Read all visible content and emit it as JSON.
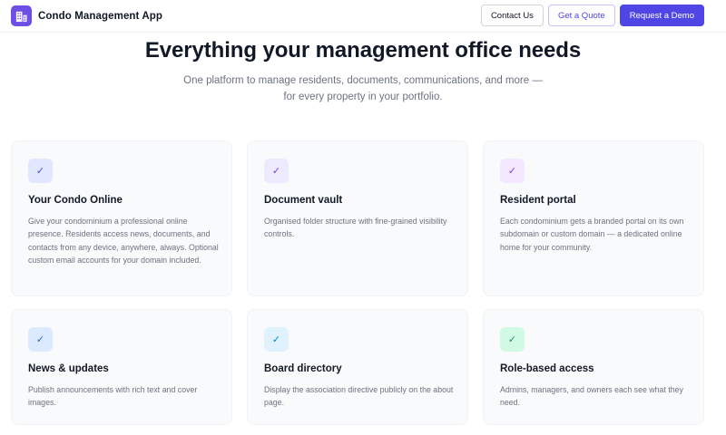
{
  "header": {
    "brand_name": "Condo Management App",
    "nav": {
      "contact_label": "Contact Us",
      "quote_label": "Get a Quote",
      "demo_label": "Request a Demo"
    }
  },
  "hero": {
    "title": "Everything your management office needs",
    "subtitle_line1": "One platform to manage residents, documents, communications, and more —",
    "subtitle_line2": "for every property in your portfolio."
  },
  "features": [
    {
      "icon": "check-icon",
      "icon_bg": "#e0e7ff",
      "icon_color": "#4f46e5",
      "title": "Your Condo Online",
      "description": "Give your condominium a professional online presence. Residents access news, documents, and contacts from any device, anywhere, always. Optional custom email accounts for your domain included."
    },
    {
      "icon": "check-icon",
      "icon_bg": "#ede9fe",
      "icon_color": "#7c3aed",
      "title": "Document vault",
      "description": "Organised folder structure with fine-grained visibility controls."
    },
    {
      "icon": "check-icon",
      "icon_bg": "#f3e8ff",
      "icon_color": "#9333ea",
      "title": "Resident portal",
      "description": "Each condominium gets a branded portal on its own subdomain or custom domain — a dedicated online home for your community."
    },
    {
      "icon": "check-icon",
      "icon_bg": "#dbeafe",
      "icon_color": "#2563eb",
      "title": "News & updates",
      "description": "Publish announcements with rich text and cover images."
    },
    {
      "icon": "check-icon",
      "icon_bg": "#e0f2fe",
      "icon_color": "#0284c7",
      "title": "Board directory",
      "description": "Display the association directive publicly on the about page."
    },
    {
      "icon": "check-icon",
      "icon_bg": "#d1fae5",
      "icon_color": "#059669",
      "title": "Role-based access",
      "description": "Admins, managers, and owners each see what they need."
    }
  ]
}
